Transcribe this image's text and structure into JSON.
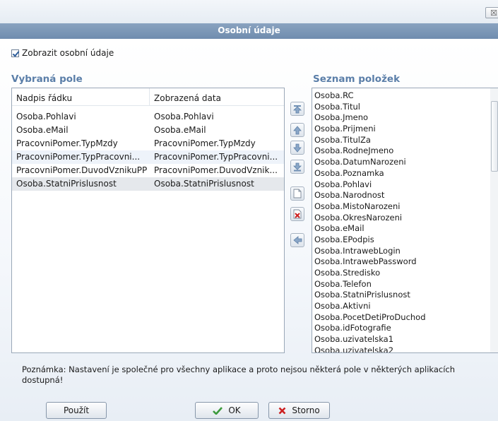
{
  "window": {
    "title": "Osobní údaje",
    "close_glyph": "☒"
  },
  "show_personal": {
    "label": "Zobrazit osobní údaje",
    "checked": true
  },
  "selected_fields": {
    "title": "Vybraná pole",
    "columns": [
      "Nadpis řádku",
      "Zobrazená data"
    ],
    "rows": [
      [
        "Osoba.Pohlavi",
        "Osoba.Pohlavi"
      ],
      [
        "Osoba.eMail",
        "Osoba.eMail"
      ],
      [
        "PracovniPomer.TypMzdy",
        "PracovniPomer.TypMzdy"
      ],
      [
        "PracovniPomer.TypPracovni...",
        "PracovniPomer.TypPracovni..."
      ],
      [
        "PracovniPomer.DuvodVznikuPP",
        "PracovniPomer.DuvodVznik..."
      ],
      [
        "Osoba.StatniPrislusnost",
        "Osoba.StatniPrislusnost"
      ]
    ]
  },
  "items_list": {
    "title": "Seznam položek",
    "items": [
      "Osoba.RC",
      "Osoba.Titul",
      "Osoba.Jmeno",
      "Osoba.Prijmeni",
      "Osoba.TitulZa",
      "Osoba.RodneJmeno",
      "Osoba.DatumNarozeni",
      "Osoba.Poznamka",
      "Osoba.Pohlavi",
      "Osoba.Narodnost",
      "Osoba.MistoNarozeni",
      "Osoba.OkresNarozeni",
      "Osoba.eMail",
      "Osoba.EPodpis",
      "Osoba.IntrawebLogin",
      "Osoba.IntrawebPassword",
      "Osoba.Stredisko",
      "Osoba.Telefon",
      "Osoba.StatniPrislusnost",
      "Osoba.Aktivni",
      "Osoba.PocetDetiProDuchod",
      "Osoba.idFotografie",
      "Osoba.uzivatelska1",
      "Osoba.uzivatelska2"
    ]
  },
  "toolbar_icons": [
    "move-top-icon",
    "move-up-icon",
    "move-down-icon",
    "move-bottom-icon",
    "new-icon",
    "delete-icon",
    "add-left-icon"
  ],
  "note": "Poznámka: Nastavení je společné pro všechny aplikace a proto nejsou některá pole v některých aplikacích dostupná!",
  "buttons": {
    "apply": "Použít",
    "ok": "OK",
    "cancel": "Storno"
  },
  "colors": {
    "title_bar": "#7893b4",
    "section_title": "#5a7ea8",
    "ok_icon": "#3c9a3c",
    "cancel_icon": "#cc1f1f"
  }
}
